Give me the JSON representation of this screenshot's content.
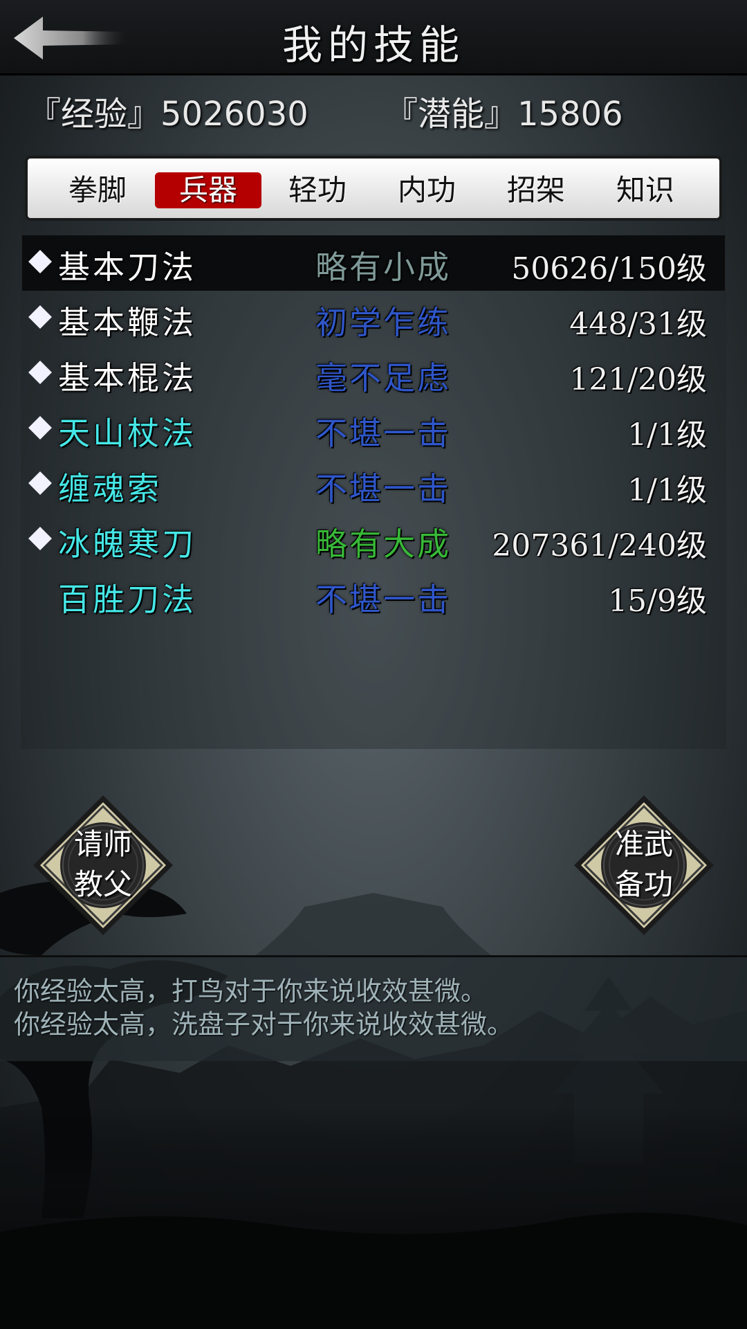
{
  "header": {
    "title": "我的技能"
  },
  "stats": {
    "experience_label": "『经验』5026030",
    "potential_label": "『潜能』15806"
  },
  "tabs": [
    {
      "label": "拳脚",
      "active": false
    },
    {
      "label": "兵器",
      "active": true
    },
    {
      "label": "轻功",
      "active": false
    },
    {
      "label": "内功",
      "active": false
    },
    {
      "label": "招架",
      "active": false
    },
    {
      "label": "知识",
      "active": false
    }
  ],
  "skills": [
    {
      "name": "基本刀法",
      "level_text": "略有小成",
      "progress": "50626/150级",
      "diamond": true,
      "selected": true,
      "name_color": "#ffffff",
      "level_color": "#7f9a98"
    },
    {
      "name": "基本鞭法",
      "level_text": "初学乍练",
      "progress": "448/31级",
      "diamond": true,
      "selected": false,
      "name_color": "#ffffff",
      "level_color": "#2f56c8"
    },
    {
      "name": "基本棍法",
      "level_text": "毫不足虑",
      "progress": "121/20级",
      "diamond": true,
      "selected": false,
      "name_color": "#ffffff",
      "level_color": "#2f56c8"
    },
    {
      "name": "天山杖法",
      "level_text": "不堪一击",
      "progress": "1/1级",
      "diamond": true,
      "selected": false,
      "name_color": "#46e6e6",
      "level_color": "#2f56c8"
    },
    {
      "name": "缠魂索",
      "level_text": "不堪一击",
      "progress": "1/1级",
      "diamond": true,
      "selected": false,
      "name_color": "#46e6e6",
      "level_color": "#2f56c8"
    },
    {
      "name": "冰魄寒刀",
      "level_text": "略有大成",
      "progress": "207361/240级",
      "diamond": true,
      "selected": false,
      "name_color": "#46e6e6",
      "level_color": "#38b838"
    },
    {
      "name": "百胜刀法",
      "level_text": "不堪一击",
      "progress": "15/9级",
      "diamond": false,
      "selected": false,
      "name_color": "#46e6e6",
      "level_color": "#2f56c8"
    }
  ],
  "buttons": {
    "left": {
      "line1": "请师",
      "line2": "教父"
    },
    "right": {
      "line1": "准武",
      "line2": "备功"
    }
  },
  "log": [
    "你经验太高，打鸟对于你来说收效甚微。",
    "你经验太高，洗盘子对于你来说收效甚微。"
  ],
  "colors": {
    "tab_active": "#b40000",
    "cyan_skill": "#46e6e6",
    "blue_level": "#2f56c8",
    "green_level": "#38b838"
  },
  "icons": {
    "back": "back-arrow-icon",
    "diamond": "diamond-bullet-icon"
  }
}
